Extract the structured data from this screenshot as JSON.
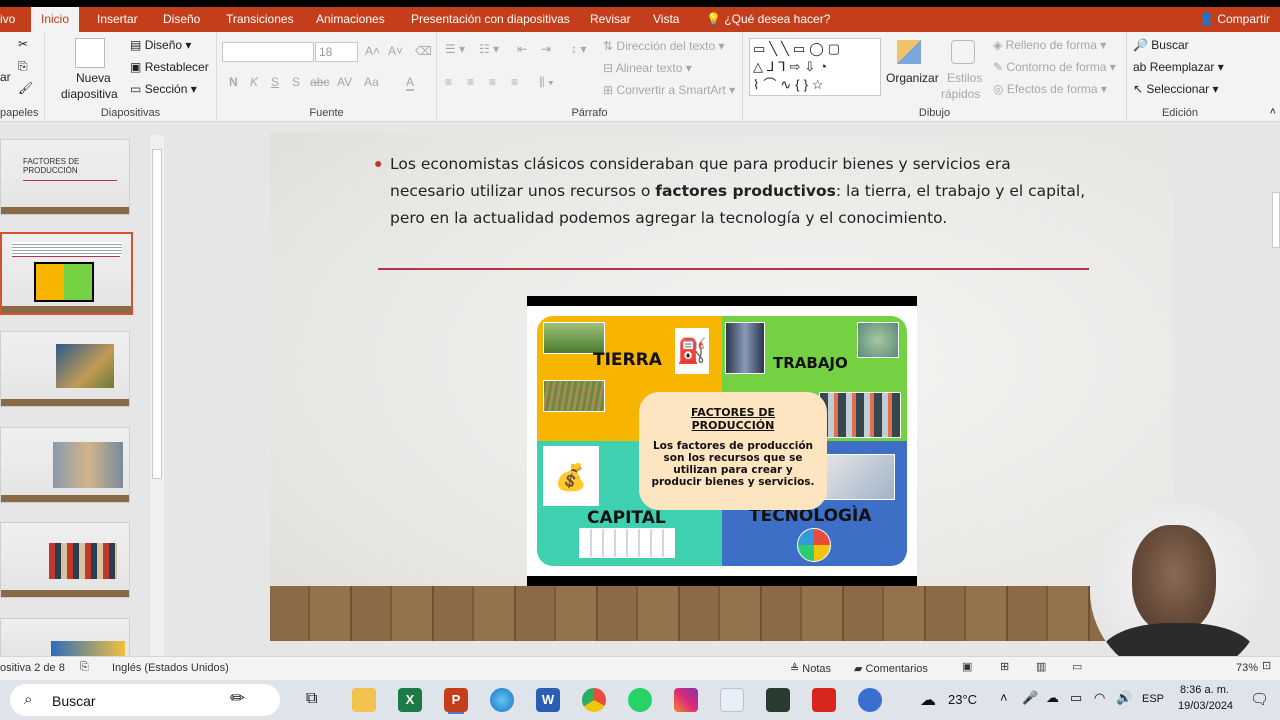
{
  "tabs": [
    "ivo",
    "Inicio",
    "Insertar",
    "Diseño",
    "Transiciones",
    "Animaciones",
    "Presentación con diapositivas",
    "Revisar",
    "Vista"
  ],
  "tell_me": "¿Qué desea hacer?",
  "share": "Compartir",
  "ribbon": {
    "clipboard_label": "papeles",
    "slides": {
      "new_slide_line1": "Nueva",
      "new_slide_line2": "diapositiva",
      "design": "Diseño",
      "reset": "Restablecer",
      "section": "Sección",
      "label": "Diapositivas"
    },
    "font": {
      "size": "18",
      "bold": "N",
      "italic": "K",
      "underline": "S",
      "shadow": "S",
      "strike": "abc",
      "spacing": "AV",
      "case": "Aa",
      "color": "A",
      "label": "Fuente"
    },
    "paragraph": {
      "text_direction": "Dirección del texto",
      "align_text": "Alinear texto",
      "smartart": "Convertir a SmartArt",
      "label": "Párrafo"
    },
    "drawing": {
      "arrange": "Organizar",
      "quick_styles_1": "Estilos",
      "quick_styles_2": "rápidos",
      "fill": "Relleno de forma",
      "outline": "Contorno de forma",
      "effects": "Efectos de forma",
      "label": "Dibujo"
    },
    "editing": {
      "find": "Buscar",
      "replace": "Reemplazar",
      "select": "Seleccionar",
      "label": "Edición"
    }
  },
  "thumbs": {
    "t1_title": "FACTORES DE PRODUCCIÓN"
  },
  "slide": {
    "text_pre": "Los economistas clásicos consideraban que para producir bienes y servicios era necesario utilizar unos recursos o ",
    "text_bold": "factores productivos",
    "text_post": ": la tierra, el trabajo y el capital, pero en la actualidad podemos agregar la tecnología y el conocimiento.",
    "infographic": {
      "tierra": "TIERRA",
      "trabajo": "TRABAJO",
      "capital": "CAPITAL",
      "tecnologia": "TECNOLOGÌA",
      "center_title": "FACTORES DE PRODUCCIÓN",
      "center_body": "Los factores de producción son los recursos que se utilizan para crear y producir bienes y servicios."
    }
  },
  "status": {
    "slide_counter": "ositiva 2 de 8",
    "language": "Inglés (Estados Unidos)",
    "notes": "Notas",
    "comments": "Comentarios",
    "zoom": "73%"
  },
  "taskbar": {
    "search": "Buscar",
    "weather": "23°C",
    "lang": "ESP",
    "time": "8:36 a. m.",
    "date": "19/03/2024"
  },
  "colors": {
    "accent": "#c43e1c",
    "tierra": "#f7b500",
    "trabajo": "#74d242",
    "capital": "#3fd0b0",
    "tecnologia": "#3d6fc7"
  }
}
